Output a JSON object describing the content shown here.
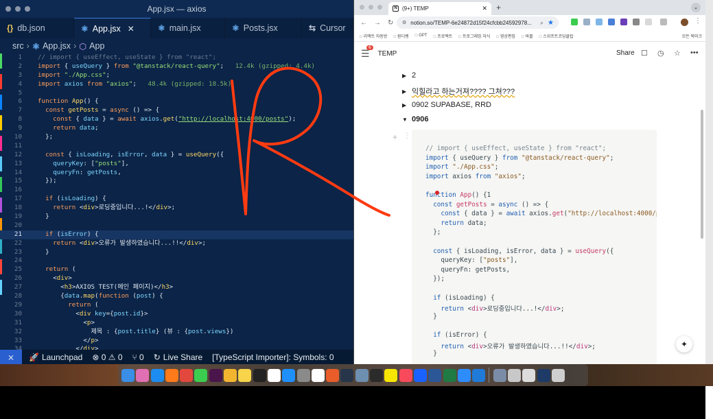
{
  "vscode": {
    "window_title": "App.jsx — axios",
    "tabs": [
      {
        "label": "db.json",
        "icon": "{}"
      },
      {
        "label": "App.jsx",
        "icon": "⚛",
        "active": true
      },
      {
        "label": "main.jsx",
        "icon": "⚛"
      },
      {
        "label": "Posts.jsx",
        "icon": "⚛"
      },
      {
        "label": "Cursor",
        "icon": "⇆"
      }
    ],
    "breadcrumb": [
      "src",
      "App.jsx",
      "App"
    ],
    "status": {
      "launchpad": "Launchpad",
      "problems": "⊗ 0 ⚠ 0",
      "ports": "⑂ 0",
      "live_share": "Live Share",
      "importer": "[TypeScript Importer]: Symbols: 0"
    },
    "code_lines": [
      {
        "n": "1",
        "html": "<span class=\"c\">// import { useEffect, useState } from \"react\";</span>"
      },
      {
        "n": "2",
        "html": "<span class=\"k\">import</span> { <span class=\"t\">useQuery</span> } <span class=\"k\">from</span> <span class=\"s\">\"@tanstack/react-query\"</span>;   <span class=\"hint\">12.4k (gzipped: 4.4k)</span>"
      },
      {
        "n": "3",
        "html": "<span class=\"k\">import</span> <span class=\"s\">\"./App.css\"</span>;"
      },
      {
        "n": "4",
        "html": "<span class=\"k\">import</span> <span class=\"t\">axios</span> <span class=\"k\">from</span> <span class=\"s\">\"axios\"</span>;   <span class=\"hint\">48.4k (gzipped: 18.5k)</span>"
      },
      {
        "n": "5",
        "html": ""
      },
      {
        "n": "6",
        "html": "<span class=\"k\">function</span> <span class=\"f\">App</span>() {"
      },
      {
        "n": "7",
        "html": "  <span class=\"k\">const</span> <span class=\"f\">getPosts</span> = <span class=\"k\">async</span> () => {"
      },
      {
        "n": "8",
        "html": "    <span class=\"k\">const</span> { <span class=\"t\">data</span> } = <span class=\"k\">await</span> <span class=\"t\">axios</span>.<span class=\"f\">get</span>(<span class=\"u\">\"http://localhost:4000/posts\"</span>);"
      },
      {
        "n": "9",
        "html": "    <span class=\"k\">return</span> <span class=\"t\">data</span>;"
      },
      {
        "n": "10",
        "html": "  };"
      },
      {
        "n": "11",
        "html": ""
      },
      {
        "n": "12",
        "html": "  <span class=\"k\">const</span> { <span class=\"t\">isLoading</span>, <span class=\"t\">isError</span>, <span class=\"t\">data</span> } = <span class=\"f\">useQuery</span>({"
      },
      {
        "n": "13",
        "html": "    <span class=\"t\">queryKey</span>: [<span class=\"s\">\"posts\"</span>],"
      },
      {
        "n": "14",
        "html": "    <span class=\"t\">queryFn</span>: <span class=\"t\">getPosts</span>,"
      },
      {
        "n": "15",
        "html": "  });"
      },
      {
        "n": "16",
        "html": ""
      },
      {
        "n": "17",
        "html": "  <span class=\"k\">if</span> (<span class=\"t\">isLoading</span>) {"
      },
      {
        "n": "18",
        "html": "    <span class=\"k\">return</span> &lt;<span class=\"f\">div</span>&gt;로딩중입니다...!&lt;/<span class=\"f\">div</span>&gt;;"
      },
      {
        "n": "19",
        "html": "  }"
      },
      {
        "n": "20",
        "html": ""
      },
      {
        "n": "21",
        "html": "  <span class=\"k\">if</span> (<span class=\"t\">isError</span>) {",
        "hl": true
      },
      {
        "n": "22",
        "html": "    <span class=\"k\">return</span> &lt;<span class=\"f\">div</span>&gt;오류가 발생하였습니다...!!&lt;/<span class=\"f\">div</span>&gt;;"
      },
      {
        "n": "23",
        "html": "  }"
      },
      {
        "n": "24",
        "html": ""
      },
      {
        "n": "25",
        "html": "  <span class=\"k\">return</span> ("
      },
      {
        "n": "26",
        "html": "    &lt;<span class=\"f\">div</span>&gt;"
      },
      {
        "n": "27",
        "html": "      &lt;<span class=\"f\">h3</span>&gt;AXIOS TEST(메인 페이지)&lt;/<span class=\"f\">h3</span>&gt;"
      },
      {
        "n": "28",
        "html": "      {<span class=\"t\">data</span>.<span class=\"f\">map</span>(<span class=\"k\">function</span> (<span class=\"t\">post</span>) {"
      },
      {
        "n": "29",
        "html": "        <span class=\"k\">return</span> ("
      },
      {
        "n": "30",
        "html": "          &lt;<span class=\"f\">div</span> <span class=\"t\">key</span>={<span class=\"t\">post</span>.<span class=\"t\">id</span>}&gt;"
      },
      {
        "n": "31",
        "html": "            &lt;<span class=\"f\">p</span>&gt;"
      },
      {
        "n": "32",
        "html": "              제목 : {<span class=\"t\">post</span>.<span class=\"t\">title</span>} (뷰 : {<span class=\"t\">post</span>.<span class=\"t\">views</span>})"
      },
      {
        "n": "33",
        "html": "            &lt;/<span class=\"f\">p</span>&gt;"
      },
      {
        "n": "34",
        "html": "          &lt;/<span class=\"f\">div</span>&gt;"
      }
    ]
  },
  "chrome": {
    "tab_title": "(9+) TEMP",
    "url": "notion.so/TEMP-6e24872d15f24cfcbb24592978...",
    "avatar_text": "",
    "bookmarks": [
      "리액트 자동방",
      "원디뱅",
      "GPT",
      "프로젝트",
      "프로그래밍 자식",
      "영상편집",
      "바볼",
      "스위프트코딩클럽"
    ],
    "all_bookmarks": "모든 북마크",
    "colors": {
      "accent": "#1a73e8"
    }
  },
  "notion": {
    "badge": "6",
    "page_title": "TEMP",
    "share": "Share",
    "toggles": [
      {
        "label": "2",
        "open": false
      },
      {
        "label": "익힐라고 하는거져???? 그쳐???",
        "open": false
      },
      {
        "label": "0902 SUPABASE, RRD",
        "open": false
      },
      {
        "label": "0906",
        "open": true,
        "bold": true
      }
    ],
    "code_lines": [
      {
        "html": "<span class=\"c\">// import { useEffect, useState } from \"react\";</span>"
      },
      {
        "html": "<span class=\"k\">import</span> { useQuery } <span class=\"k\">from</span> <span class=\"s\">\"@tanstack/react-query\"</span>;"
      },
      {
        "html": "<span class=\"k\">import</span> <span class=\"s\">\"./App.css\"</span>;"
      },
      {
        "html": "<span class=\"k\">import</span> axios <span class=\"k\">from</span> <span class=\"s\">\"axios\"</span>;"
      },
      {
        "html": ""
      },
      {
        "html": "<span class=\"k\">function</span> <span class=\"f\">App</span>() {1"
      },
      {
        "html": "  <span class=\"k\">const</span> <span class=\"f\">getPosts</span> = <span class=\"k\">async</span> () => {"
      },
      {
        "html": "    <span class=\"k\">const</span> { data } = <span class=\"k\">await</span> axios.<span class=\"f\">get</span>(<span class=\"s\">\"http://localhost:4000/posts\"</span>);"
      },
      {
        "html": "    <span class=\"k\">return</span> data;"
      },
      {
        "html": "  };"
      },
      {
        "html": ""
      },
      {
        "html": "  <span class=\"k\">const</span> { isLoading, isError, data } = <span class=\"f\">useQuery</span>({"
      },
      {
        "html": "    queryKey: [<span class=\"s\">\"posts\"</span>],"
      },
      {
        "html": "    queryFn: getPosts,"
      },
      {
        "html": "  });"
      },
      {
        "html": ""
      },
      {
        "html": "  <span class=\"k\">if</span> (isLoading) {"
      },
      {
        "html": "    <span class=\"k\">return</span> &lt;<span class=\"t\">div</span>&gt;로딩중입니다...!&lt;/<span class=\"t\">div</span>&gt;;"
      },
      {
        "html": "  }"
      },
      {
        "html": ""
      },
      {
        "html": "  <span class=\"k\">if</span> (isError) {"
      },
      {
        "html": "    <span class=\"k\">return</span> &lt;<span class=\"t\">div</span>&gt;오류가 발생하였습니다...!!&lt;/<span class=\"t\">div</span>&gt;;"
      },
      {
        "html": "  }"
      }
    ]
  },
  "dock": {
    "apps": [
      {
        "name": "finder",
        "color": "#3a8ee6"
      },
      {
        "name": "launchpad",
        "color": "#e06fb3"
      },
      {
        "name": "safari",
        "color": "#1c8cf0"
      },
      {
        "name": "firefox",
        "color": "#ff7a1a"
      },
      {
        "name": "chrome",
        "color": "#e2483d"
      },
      {
        "name": "messages",
        "color": "#3ccc4f"
      },
      {
        "name": "slack",
        "color": "#4a154b"
      },
      {
        "name": "photos",
        "color": "#f2b530"
      },
      {
        "name": "notes",
        "color": "#f7d44a"
      },
      {
        "name": "terminal",
        "color": "#222222"
      },
      {
        "name": "calendar",
        "color": "#ffffff"
      },
      {
        "name": "app-store",
        "color": "#1e90ff"
      },
      {
        "name": "system-settings",
        "color": "#8a8a8a"
      },
      {
        "name": "notion",
        "color": "#ffffff"
      },
      {
        "name": "keynote",
        "color": "#e85d2a"
      },
      {
        "name": "quicktime",
        "color": "#27354a"
      },
      {
        "name": "preview",
        "color": "#6d8fb0"
      },
      {
        "name": "capcut",
        "color": "#2b2b2b"
      },
      {
        "name": "kakaotalk",
        "color": "#f7e600"
      },
      {
        "name": "music",
        "color": "#f94a5b"
      },
      {
        "name": "shazam",
        "color": "#1a62ff"
      },
      {
        "name": "word",
        "color": "#2b5797"
      },
      {
        "name": "excel",
        "color": "#1f7a44"
      },
      {
        "name": "zoom",
        "color": "#2d8cff"
      },
      {
        "name": "vscode",
        "color": "#1f7ad8"
      }
    ],
    "files": [
      {
        "name": "folder-1",
        "color": "#7a8ca6"
      },
      {
        "name": "folder-2",
        "color": "#c8c8c8"
      },
      {
        "name": "folder-3",
        "color": "#dcdcdc"
      },
      {
        "name": "folder-4",
        "color": "#1e3a66"
      },
      {
        "name": "trash",
        "color": "#cfcfcf"
      }
    ]
  }
}
